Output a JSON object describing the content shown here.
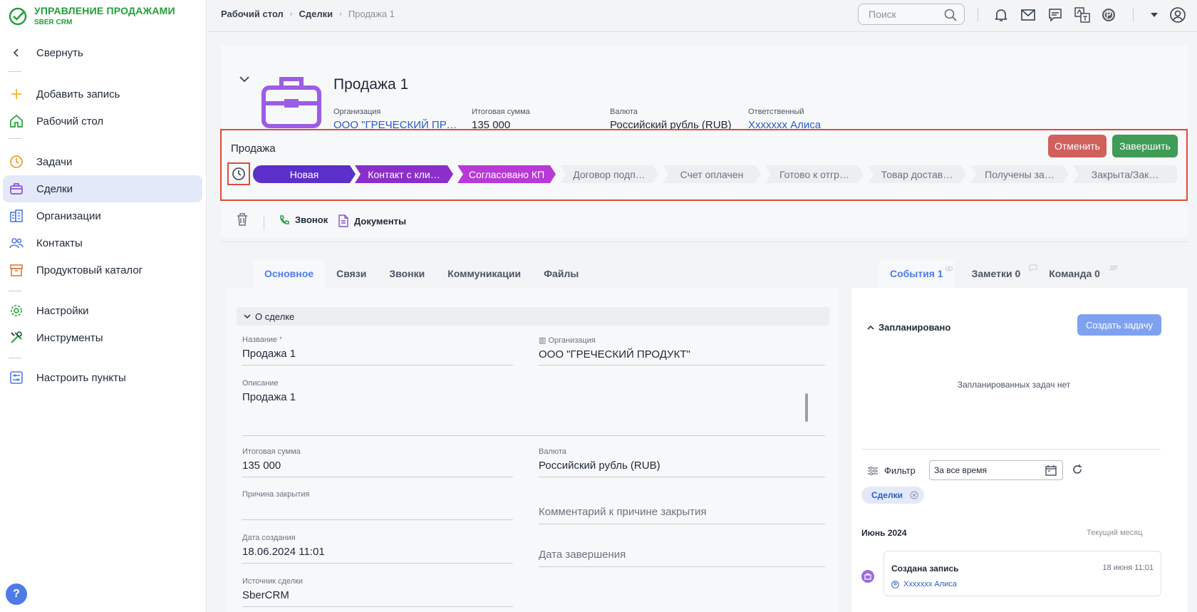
{
  "app": {
    "title": "УПРАВЛЕНИЕ ПРОДАЖАМИ",
    "subtitle": "SBER CRM"
  },
  "sidebar": {
    "collapse": "Свернуть",
    "items": [
      {
        "label": "Добавить запись",
        "icon": "plus-icon"
      },
      {
        "label": "Рабочий стол",
        "icon": "home-icon"
      },
      {
        "label": "Задачи",
        "icon": "clock-icon"
      },
      {
        "label": "Сделки",
        "icon": "briefcase-icon",
        "active": true
      },
      {
        "label": "Организации",
        "icon": "buildings-icon"
      },
      {
        "label": "Контакты",
        "icon": "people-icon"
      },
      {
        "label": "Продуктовый каталог",
        "icon": "box-icon"
      },
      {
        "label": "Настройки",
        "icon": "gear-icon"
      },
      {
        "label": "Инструменты",
        "icon": "tools-icon"
      },
      {
        "label": "Настроить пункты",
        "icon": "sliders-icon"
      }
    ],
    "help": "?"
  },
  "topbar": {
    "breadcrumbs": [
      "Рабочий стол",
      "Сделки",
      "Продажа 1"
    ],
    "search_placeholder": "Поиск"
  },
  "deal": {
    "title": "Продажа 1",
    "fields": [
      {
        "label": "Организация",
        "value": "ООО \"ГРЕЧЕСКИЙ ПРО…"
      },
      {
        "label": "Итоговая сумма",
        "value": "135 000"
      },
      {
        "label": "Валюта",
        "value": "Российский рубль (RUB)"
      },
      {
        "label": "Ответственный",
        "value": "Xxxxxxx Алиса"
      }
    ]
  },
  "pipeline": {
    "label": "Продажа",
    "cancel": "Отменить",
    "finish": "Завершить",
    "stages": [
      "Новая",
      "Контакт с кли…",
      "Согласовано КП",
      "Договор подп…",
      "Счет оплачен",
      "Готово к отгр…",
      "Товар достав…",
      "Получены за…",
      "Закрыта/Зак…"
    ],
    "completed_count": 3
  },
  "actions": {
    "call": "Звонок",
    "documents": "Документы"
  },
  "tabs_left": [
    "Основное",
    "Связи",
    "Звонки",
    "Коммуникации",
    "Файлы"
  ],
  "about": {
    "header": "О сделке",
    "name_label": "Название",
    "name_value": "Продажа 1",
    "org_label": "Организация",
    "org_value": "ООО \"ГРЕЧЕСКИЙ ПРОДУКТ\"",
    "desc_label": "Описание",
    "desc_value": "Продажа 1",
    "sum_label": "Итоговая сумма",
    "sum_value": "135 000",
    "currency_label": "Валюта",
    "currency_value": "Российский рубль (RUB)",
    "close_reason_label": "Причина закрытия",
    "close_comment_placeholder": "Комментарий к причине закрытия",
    "created_label": "Дата создания",
    "created_value": "18.06.2024 11:01",
    "finish_date_placeholder": "Дата завершения",
    "source_label": "Источник сделки",
    "source_value": "SberCRM"
  },
  "tabs_right": [
    "События 1",
    "Заметки 0",
    "Команда 0"
  ],
  "events": {
    "planned": "Запланировано",
    "create_task": "Создать задачу",
    "no_tasks": "Запланированных задач нет",
    "filter": "Фильтр",
    "period": "За все время",
    "chip": "Сделки",
    "month": "Июнь 2024",
    "current_month": "Текущий месяц",
    "item_title": "Создана запись",
    "item_time": "18 июня 11:01",
    "item_user": "Xxxxxxx Алиса"
  },
  "colors": {
    "brand": "#21a038",
    "accent": "#4f7be8",
    "danger": "#d0605c",
    "success": "#3f9b55",
    "stage_active": "#5b2fc9"
  }
}
